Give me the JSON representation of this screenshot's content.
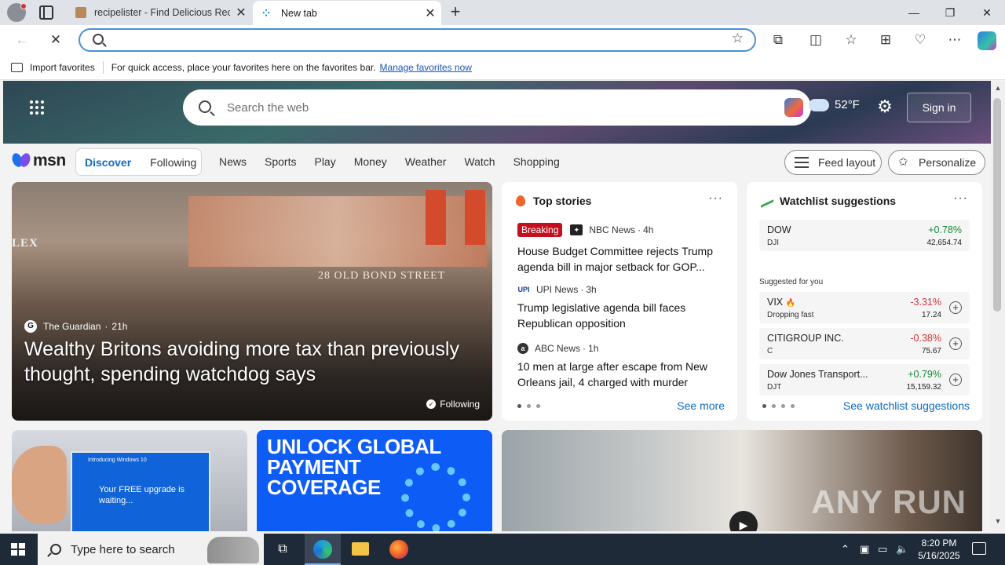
{
  "browser": {
    "tabs": [
      {
        "title": "recipelister - Find Delicious Recip",
        "active": false
      },
      {
        "title": "New tab",
        "active": true
      }
    ],
    "address_value": "",
    "favorites_bar": {
      "import_label": "Import favorites",
      "message": "For quick access, place your favorites here on the favorites bar.",
      "link": "Manage favorites now"
    }
  },
  "msn": {
    "search_placeholder": "Search the web",
    "weather": {
      "temp": "52",
      "unit": "°F"
    },
    "sign_in": "Sign in",
    "logo_text": "msn",
    "segments": [
      "Discover",
      "Following"
    ],
    "nav": [
      "News",
      "Sports",
      "Play",
      "Money",
      "Weather",
      "Watch",
      "Shopping"
    ],
    "feed_layout": "Feed layout",
    "personalize": "Personalize"
  },
  "hero": {
    "source": "The Guardian",
    "age": "21h",
    "headline": "Wealthy Britons avoiding more tax than previously thought, spending watchdog says",
    "following": "Following",
    "sign_text": "28 OLD BOND STREET",
    "rolex_text": "LEX"
  },
  "top_stories": {
    "title": "Top stories",
    "items": [
      {
        "badge": "Breaking",
        "source": "NBC News",
        "age": "4h",
        "title": "House Budget Committee rejects Trump agenda bill in major setback for GOP..."
      },
      {
        "badge": "",
        "source": "UPI News",
        "age": "3h",
        "title": "Trump legislative agenda bill faces Republican opposition"
      },
      {
        "badge": "",
        "source": "ABC News",
        "age": "1h",
        "title": "10 men at large after escape from New Orleans jail, 4 charged with murder"
      }
    ],
    "see_more": "See more"
  },
  "watchlist": {
    "title": "Watchlist suggestions",
    "suggested_label": "Suggested for you",
    "rows": [
      {
        "name": "DOW",
        "sub": "DJI",
        "change": "+0.78%",
        "price": "42,654.74",
        "dir": "up"
      },
      {
        "name": "VIX",
        "sub": "Dropping fast",
        "change": "-3.31%",
        "price": "17.24",
        "dir": "down"
      },
      {
        "name": "CITIGROUP INC.",
        "sub": "C",
        "change": "-0.38%",
        "price": "75.67",
        "dir": "down"
      },
      {
        "name": "Dow Jones Transport...",
        "sub": "DJT",
        "change": "+0.79%",
        "price": "15,159.32",
        "dir": "up"
      }
    ],
    "see_link": "See watchlist suggestions"
  },
  "tiles": {
    "win_title": "Introducing Windows 10",
    "win_body": "Your FREE upgrade is waiting...",
    "ad_text": "UNLOCK GLOBAL PAYMENT COVERAGE",
    "ad_lines": [
      "UNLOCK GLOBAL",
      "PAYMENT",
      "COVERAGE"
    ],
    "watermark": "ANY RUN"
  },
  "taskbar": {
    "search_placeholder": "Type here to search",
    "time": "8:20 PM",
    "date": "5/16/2025"
  },
  "colors": {
    "accent": "#0f6cbd",
    "up": "#138a36",
    "down": "#d13438",
    "breaking": "#c50f1f"
  }
}
